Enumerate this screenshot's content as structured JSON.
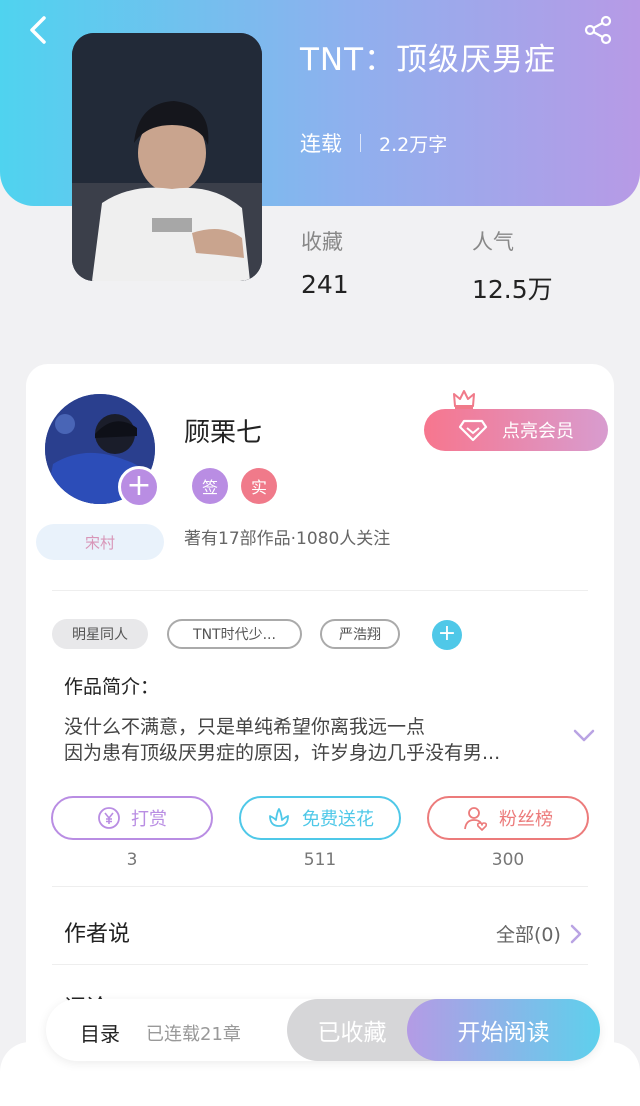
{
  "header": {
    "title": "TNT：顶级厌男症",
    "status": "连载",
    "word_count": "2.2万字",
    "stats": [
      {
        "label": "收藏",
        "value": "241"
      },
      {
        "label": "人气",
        "value": "12.5万"
      }
    ],
    "icons": {
      "back": "chevron-left-icon",
      "share": "share-icon"
    }
  },
  "author": {
    "name": "顾栗七",
    "badges": [
      "签",
      "实"
    ],
    "badge_colors": [
      "#b98de3",
      "#f07a8a"
    ],
    "info": "著有17部作品·1080人关注",
    "badge_label": "宋村",
    "follow_icon": "plus-icon",
    "vip_button": "点亮会员"
  },
  "tags": [
    "明星同人",
    "TNT时代少...",
    "严浩翔"
  ],
  "intro": {
    "title": "作品简介：",
    "lines": [
      "没什么不满意，只是单纯希望你离我远一点",
      "因为患有顶级厌男症的原因，许岁身边几乎没有男..."
    ]
  },
  "actions": [
    {
      "label": "打赏",
      "count": "3",
      "color": "#b98de3",
      "icon": "yen-coin-icon"
    },
    {
      "label": "免费送花",
      "count": "511",
      "color": "#4fc8e8",
      "icon": "flower-icon"
    },
    {
      "label": "粉丝榜",
      "count": "300",
      "color": "#ec7b7b",
      "icon": "fan-user-icon"
    }
  ],
  "author_says": {
    "title": "作者说",
    "more": "全部(0)"
  },
  "comments": {
    "title": "评论"
  },
  "bottom_bar": {
    "toc": "目录",
    "chapters": "已连载21章",
    "collected": "已收藏",
    "read": "开始阅读"
  }
}
